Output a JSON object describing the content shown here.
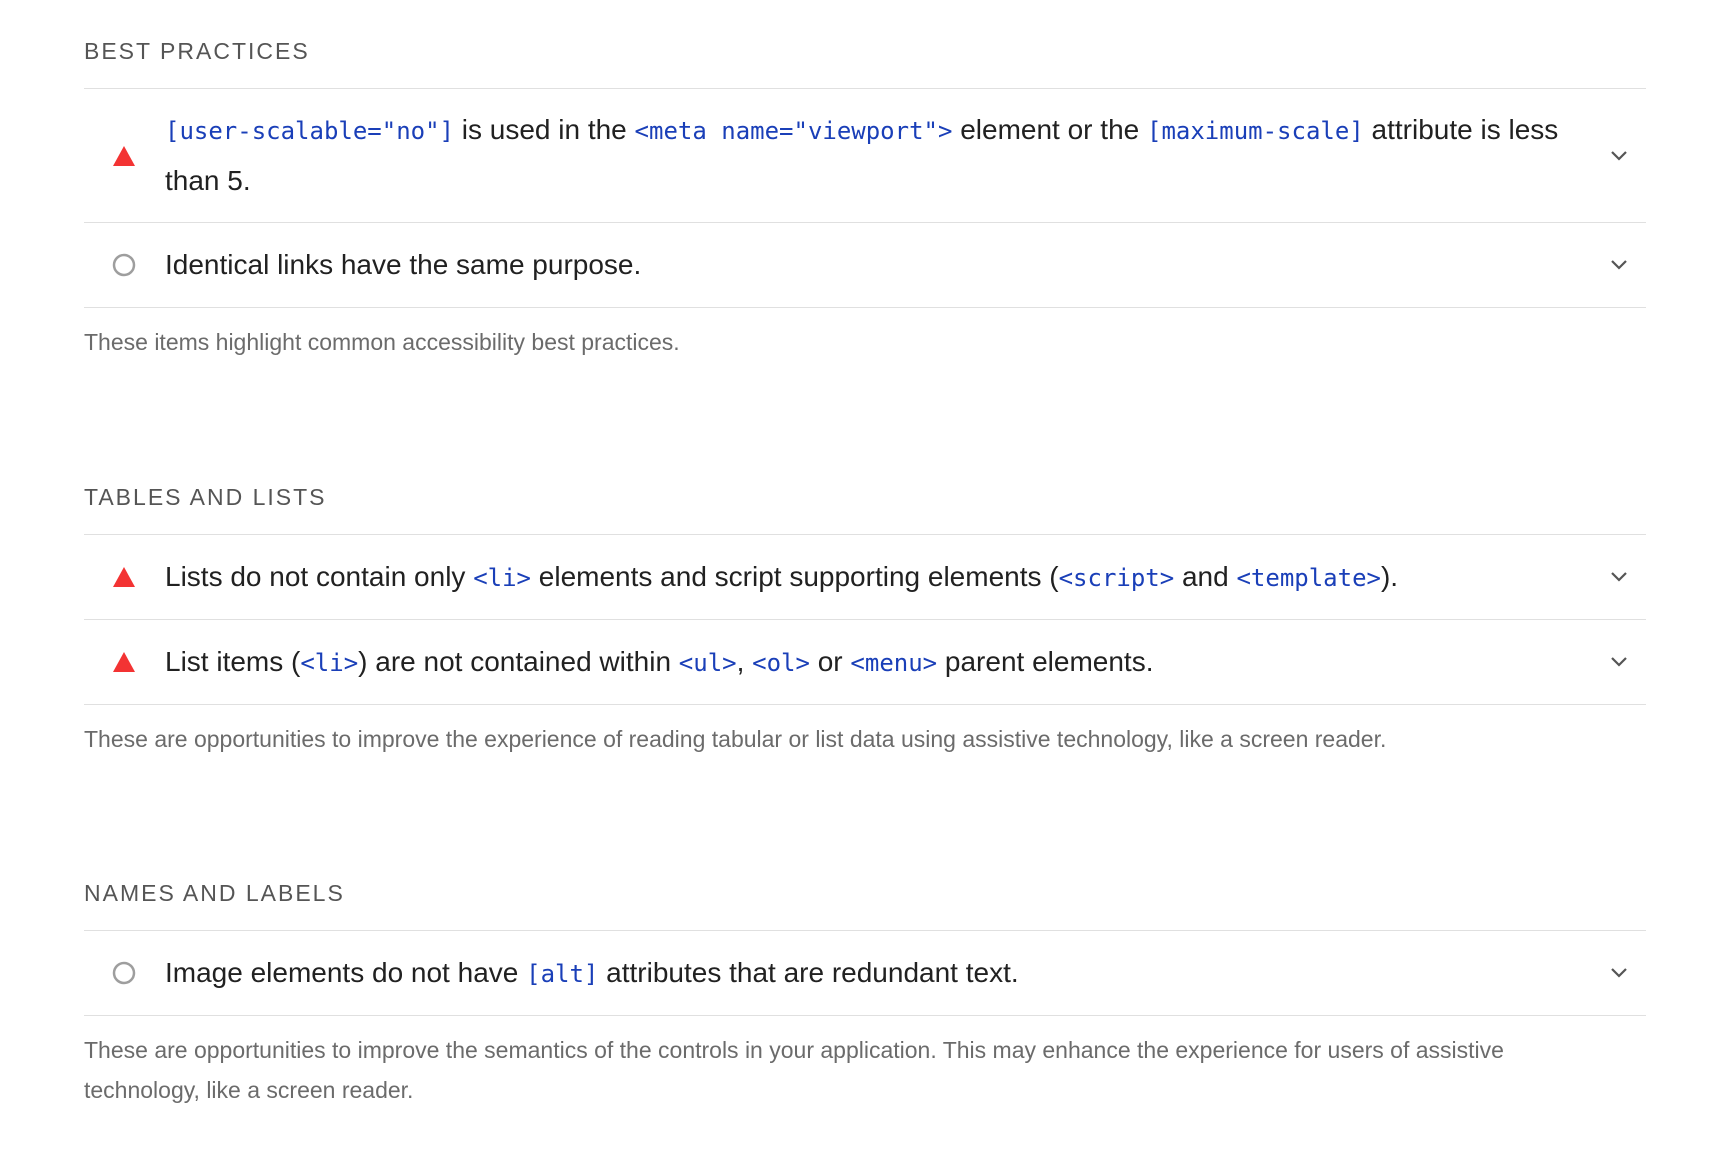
{
  "groups": [
    {
      "title": "BEST PRACTICES",
      "audits": [
        {
          "status": "fail",
          "parts": [
            {
              "t": "code",
              "v": "[user-scalable=\"no\"]"
            },
            {
              "t": "text",
              "v": " is used in the "
            },
            {
              "t": "code",
              "v": "<meta name=\"viewport\">"
            },
            {
              "t": "text",
              "v": " element or the "
            },
            {
              "t": "code",
              "v": "[maximum-scale]"
            },
            {
              "t": "text",
              "v": " attribute is less than 5."
            }
          ]
        },
        {
          "status": "na",
          "parts": [
            {
              "t": "text",
              "v": "Identical links have the same purpose."
            }
          ]
        }
      ],
      "description": "These items highlight common accessibility best practices."
    },
    {
      "title": "TABLES AND LISTS",
      "audits": [
        {
          "status": "fail",
          "parts": [
            {
              "t": "text",
              "v": "Lists do not contain only "
            },
            {
              "t": "code",
              "v": "<li>"
            },
            {
              "t": "text",
              "v": " elements and script supporting elements ("
            },
            {
              "t": "code",
              "v": "<script>"
            },
            {
              "t": "text",
              "v": " and "
            },
            {
              "t": "code",
              "v": "<template>"
            },
            {
              "t": "text",
              "v": ")."
            }
          ]
        },
        {
          "status": "fail",
          "parts": [
            {
              "t": "text",
              "v": "List items ("
            },
            {
              "t": "code",
              "v": "<li>"
            },
            {
              "t": "text",
              "v": ") are not contained within "
            },
            {
              "t": "code",
              "v": "<ul>"
            },
            {
              "t": "text",
              "v": ", "
            },
            {
              "t": "code",
              "v": "<ol>"
            },
            {
              "t": "text",
              "v": " or "
            },
            {
              "t": "code",
              "v": "<menu>"
            },
            {
              "t": "text",
              "v": " parent elements."
            }
          ]
        }
      ],
      "description": "These are opportunities to improve the experience of reading tabular or list data using assistive technology, like a screen reader."
    },
    {
      "title": "NAMES AND LABELS",
      "audits": [
        {
          "status": "na",
          "parts": [
            {
              "t": "text",
              "v": "Image elements do not have "
            },
            {
              "t": "code",
              "v": "[alt]"
            },
            {
              "t": "text",
              "v": " attributes that are redundant text."
            }
          ]
        }
      ],
      "description": "These are opportunities to improve the semantics of the controls in your application. This may enhance the experience for users of assistive technology, like a screen reader."
    }
  ],
  "icons": {
    "fail": "warning-triangle-icon",
    "na": "empty-circle-icon",
    "expand": "chevron-down-icon"
  },
  "colors": {
    "fail": "#f33333",
    "na": "#9e9e9e",
    "code": "#1a3fb8"
  }
}
